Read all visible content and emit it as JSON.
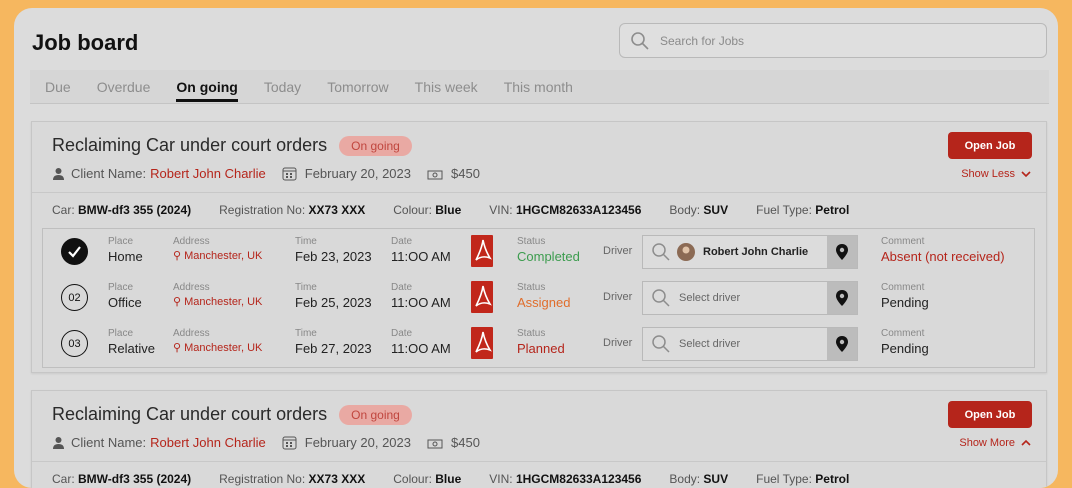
{
  "header": {
    "title": "Job board",
    "search_placeholder": "Search for Jobs"
  },
  "tabs": [
    {
      "label": "Due"
    },
    {
      "label": "Overdue"
    },
    {
      "label": "On going",
      "active": true
    },
    {
      "label": "Today"
    },
    {
      "label": "Tomorrow"
    },
    {
      "label": "This week"
    },
    {
      "label": "This month"
    }
  ],
  "colors": {
    "accent": "#b5251b",
    "badge_bg": "#e9a9a3",
    "completed": "#3c9c4e",
    "assigned": "#e06d2b"
  },
  "jobs": [
    {
      "title": "Reclaiming Car under court orders",
      "status": "On going",
      "client_label": "Client Name:",
      "client_name": "Robert John Charlie",
      "date": "February 20, 2023",
      "price": "$450",
      "open_label": "Open Job",
      "toggle_label": "Show Less",
      "specs": {
        "car_label": "Car:",
        "car": "BMW-df3 355 (2024)",
        "reg_label": "Registration No:",
        "reg": "XX73 XXX",
        "colour_label": "Colour:",
        "colour": "Blue",
        "vin_label": "VIN:",
        "vin": "1HGCM82633A123456",
        "body_label": "Body:",
        "body": "SUV",
        "fuel_label": "Fuel Type:",
        "fuel": "Petrol"
      },
      "stops": [
        {
          "num": "",
          "done": true,
          "place": "Home",
          "address": "Manchester, UK",
          "time": "Feb 23, 2023",
          "date": "11:OO AM",
          "status": "Completed",
          "driver": "Robert John Charlie",
          "comment": "Absent (not received)"
        },
        {
          "num": "02",
          "done": false,
          "place": "Office",
          "address": "Manchester, UK",
          "time": "Feb 25, 2023",
          "date": "11:OO AM",
          "status": "Assigned",
          "driver": "",
          "comment": "Pending"
        },
        {
          "num": "03",
          "done": false,
          "place": "Relative",
          "address": "Manchester, UK",
          "time": "Feb 27, 2023",
          "date": "11:OO AM",
          "status": "Planned",
          "driver": "",
          "comment": "Pending"
        }
      ]
    },
    {
      "title": "Reclaiming Car under court orders",
      "status": "On going",
      "client_label": "Client Name:",
      "client_name": "Robert John Charlie",
      "date": "February 20, 2023",
      "price": "$450",
      "open_label": "Open Job",
      "toggle_label": "Show More",
      "specs": {
        "car_label": "Car:",
        "car": "BMW-df3 355 (2024)",
        "reg_label": "Registration No:",
        "reg": "XX73 XXX",
        "colour_label": "Colour:",
        "colour": "Blue",
        "vin_label": "VIN:",
        "vin": "1HGCM82633A123456",
        "body_label": "Body:",
        "body": "SUV",
        "fuel_label": "Fuel Type:",
        "fuel": "Petrol"
      }
    }
  ],
  "labels": {
    "place": "Place",
    "address": "Address",
    "time": "Time",
    "date": "Date",
    "status": "Status",
    "driver": "Driver",
    "comment": "Comment",
    "select_driver": "Select driver"
  }
}
